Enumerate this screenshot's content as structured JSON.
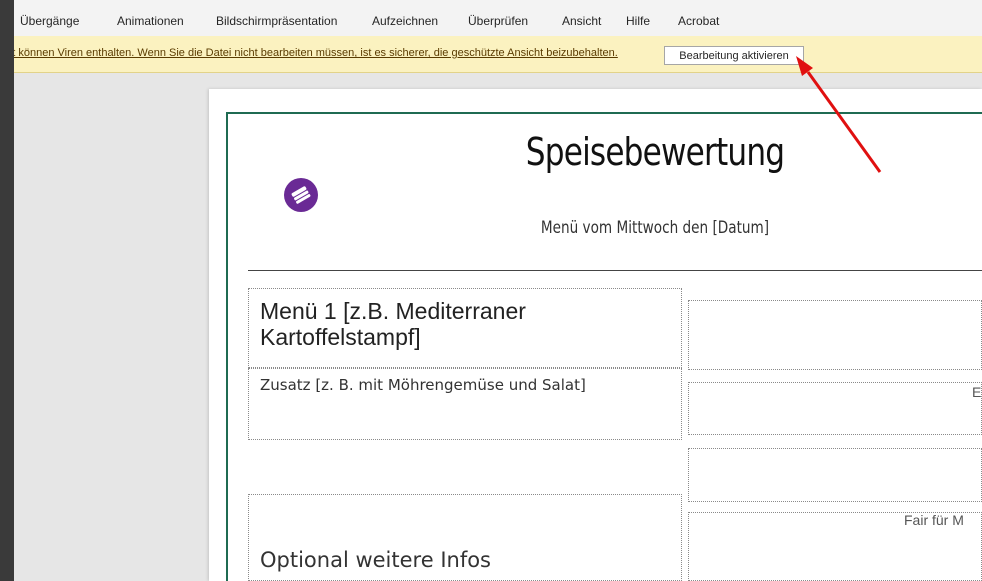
{
  "ribbon": {
    "tabs": [
      "Übergänge",
      "Animationen",
      "Bildschirmpräsentation",
      "Aufzeichnen",
      "Überprüfen",
      "Ansicht",
      "Hilfe",
      "Acrobat"
    ]
  },
  "protected_view": {
    "message": "net können Viren enthalten. Wenn Sie die Datei nicht bearbeiten müssen, ist es sicherer, die geschützte Ansicht beizubehalten.",
    "enable_button": "Bearbeitung aktivieren"
  },
  "slide": {
    "title": "Speisebewertung",
    "subtitle": "Menü vom Mittwoch den [Datum]",
    "menu_title": "Menü 1 [z.B. Mediterraner Kartoffelstampf]",
    "menu_extra": "Zusatz [z. B. mit Möhrengemüse und Salat]",
    "optional_info": "Optional weitere Infos",
    "right_fragment_1": "E",
    "right_fragment_2": "Fair für M"
  },
  "colors": {
    "message_bar": "#fbf2c0",
    "slide_border": "#1f6b52",
    "logo": "#6a2a95",
    "arrow": "#e01010"
  },
  "icons": {
    "logo": "fork-knife-icon"
  }
}
